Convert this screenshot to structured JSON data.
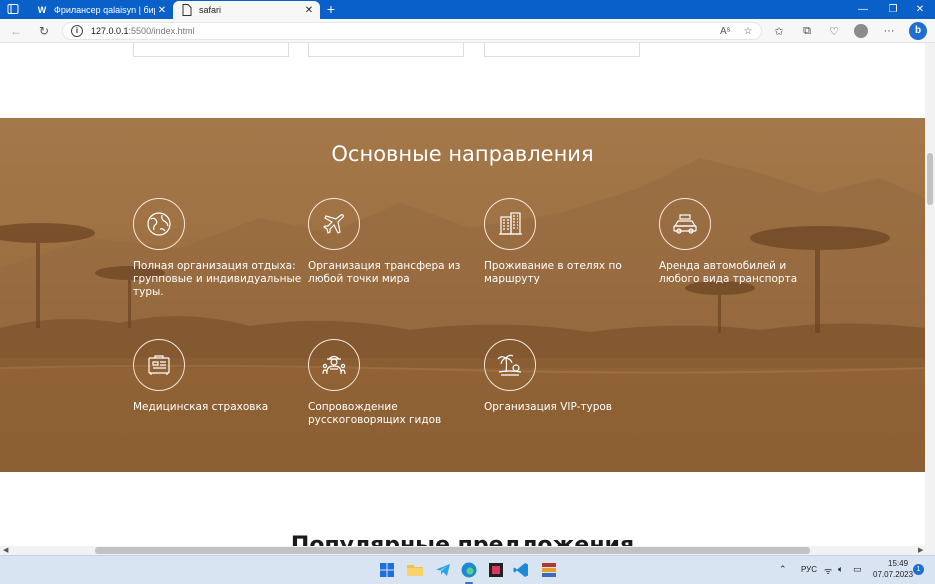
{
  "browser": {
    "tabs": [
      {
        "favicon": "W",
        "title": "Фрилансер qalaisyn | биржа фр..."
      },
      {
        "favicon": "page-icon",
        "title": "safari"
      }
    ],
    "url_host": "127.0.0.1",
    "url_path": ":5500/index.html",
    "read_aloud": "Aˢ"
  },
  "section": {
    "title": "Основные направления",
    "services": [
      {
        "icon": "globe-icon",
        "label": "Полная организация отдыха: групповые и индивидуальные туры."
      },
      {
        "icon": "airplane-icon",
        "label": "Организация трансфера из любой точки мира"
      },
      {
        "icon": "hotel-building-icon",
        "label": "Проживание в отелях по маршруту"
      },
      {
        "icon": "car-icon",
        "label": "Аренда автомобилей и любого вида транспорта"
      },
      {
        "icon": "medical-insurance-icon",
        "label": "Медицинская страховка"
      },
      {
        "icon": "tour-guide-icon",
        "label": "Сопровождение русскоговорящих гидов"
      },
      {
        "icon": "palm-beach-icon",
        "label": "Организация VIP-туров"
      }
    ]
  },
  "next_section": {
    "title": "Популярные предложения"
  },
  "taskbar": {
    "lang": "РУС",
    "time": "15:49",
    "date": "07.07.2023",
    "notifications": "1"
  },
  "colors": {
    "tabbar": "#0a60c9",
    "section_bg": "#9c6f3e"
  }
}
